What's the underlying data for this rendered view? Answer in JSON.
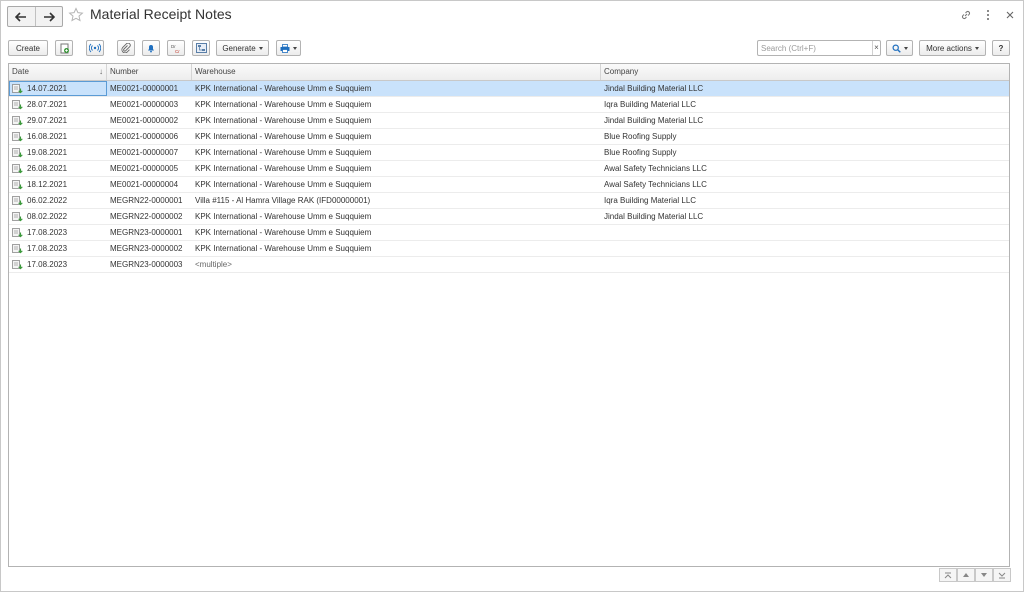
{
  "window": {
    "title": "Material Receipt Notes"
  },
  "toolbar": {
    "create_label": "Create",
    "generate_label": "Generate",
    "more_actions_label": "More actions",
    "help_label": "?",
    "search_placeholder": "Search (Ctrl+F)",
    "search_clear": "×"
  },
  "table": {
    "columns": [
      "Date",
      "Number",
      "Warehouse",
      "Company"
    ],
    "sort_indicator": "↓",
    "rows": [
      {
        "date": "14.07.2021",
        "number": "ME0021-00000001",
        "warehouse": "KPK International - Warehouse Umm e Suqquiem",
        "company": "Jindal Building Material LLC"
      },
      {
        "date": "28.07.2021",
        "number": "ME0021-00000003",
        "warehouse": "KPK International - Warehouse Umm e Suqquiem",
        "company": "Iqra Building Material LLC"
      },
      {
        "date": "29.07.2021",
        "number": "ME0021-00000002",
        "warehouse": "KPK International - Warehouse Umm e Suqquiem",
        "company": "Jindal Building Material LLC"
      },
      {
        "date": "16.08.2021",
        "number": "ME0021-00000006",
        "warehouse": "KPK International - Warehouse Umm e Suqquiem",
        "company": "Blue Roofing Supply"
      },
      {
        "date": "19.08.2021",
        "number": "ME0021-00000007",
        "warehouse": "KPK International - Warehouse Umm e Suqquiem",
        "company": "Blue Roofing Supply"
      },
      {
        "date": "26.08.2021",
        "number": "ME0021-00000005",
        "warehouse": "KPK International - Warehouse Umm e Suqquiem",
        "company": "Awal Safety Technicians LLC"
      },
      {
        "date": "18.12.2021",
        "number": "ME0021-00000004",
        "warehouse": "KPK International - Warehouse Umm e Suqquiem",
        "company": "Awal Safety Technicians LLC"
      },
      {
        "date": "06.02.2022",
        "number": "MEGRN22-0000001",
        "warehouse": "Villa #115 - Al Hamra Village RAK (IFD00000001)",
        "company": "Iqra Building Material LLC"
      },
      {
        "date": "08.02.2022",
        "number": "MEGRN22-0000002",
        "warehouse": "KPK International - Warehouse Umm e Suqquiem",
        "company": "Jindal Building Material LLC"
      },
      {
        "date": "17.08.2023",
        "number": "MEGRN23-0000001",
        "warehouse": "KPK International - Warehouse Umm e Suqquiem",
        "company": ""
      },
      {
        "date": "17.08.2023",
        "number": "MEGRN23-0000002",
        "warehouse": "KPK International - Warehouse Umm e Suqquiem",
        "company": ""
      },
      {
        "date": "17.08.2023",
        "number": "MEGRN23-0000003",
        "warehouse": "<multiple>",
        "company": ""
      }
    ]
  },
  "colors": {
    "selected_row": "#c9e2fb",
    "icon_green": "#3c9a3c",
    "accent_blue": "#1f6fbf"
  }
}
